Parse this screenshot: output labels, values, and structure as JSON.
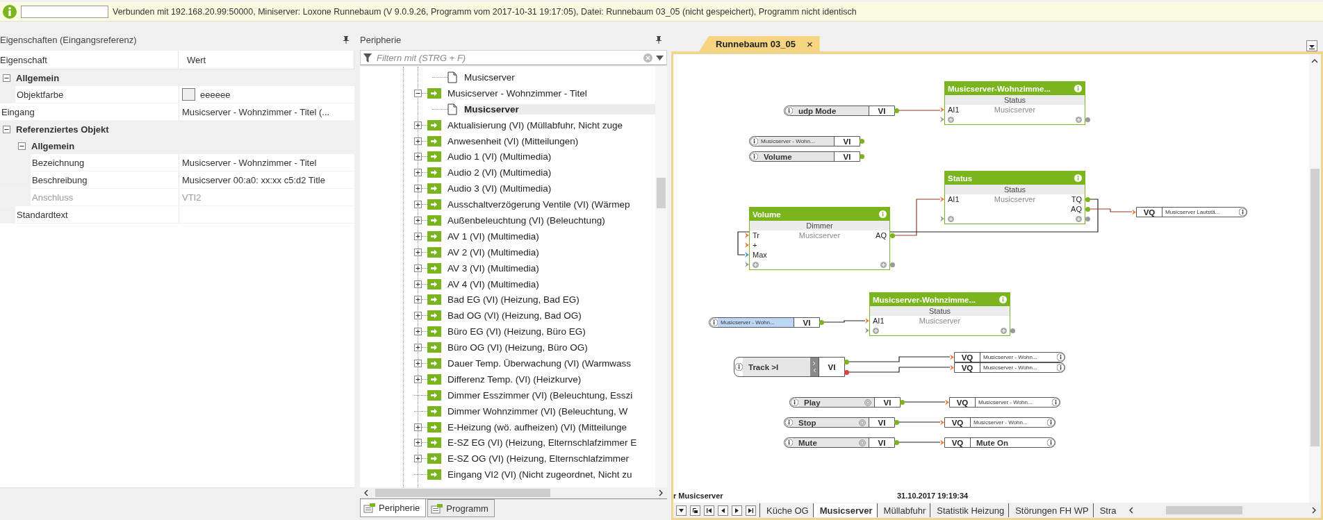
{
  "status_bar": {
    "message": "Verbunden mit 192.168.20.99:50000, Miniserver: Loxone Runnebaum (V 9.0.9.26, Programm vom 2017-10-31 19:17:05), Datei: Runnebaum 03_05 (nicht gespeichert), Programm nicht identisch"
  },
  "properties": {
    "title": "Eigenschaften (Eingangsreferenz)",
    "columns": [
      "Eigenschaft",
      "Wert"
    ],
    "rows": [
      {
        "kind": "category",
        "label": "Allgemein",
        "expanded": true,
        "children": [
          {
            "kind": "color",
            "label": "Objektfarbe",
            "value": "eeeeee",
            "color": "#eeeeee",
            "disabled": false
          }
        ]
      },
      {
        "kind": "property",
        "label": "Eingang",
        "value": "Musicserver - Wohnzimmer - Titel (...",
        "disabled": false
      },
      {
        "kind": "category",
        "label": "Referenziertes Objekt",
        "expanded": true,
        "children": [
          {
            "kind": "category",
            "label": "Allgemein",
            "expanded": true,
            "children": [
              {
                "kind": "property",
                "label": "Bezeichnung",
                "value": "Musicserver - Wohnzimmer - Titel",
                "disabled": false
              },
              {
                "kind": "property",
                "label": "Beschreibung",
                "value": "Musicserver 00:a0: xx:xx c5:d2 Title",
                "disabled": false
              },
              {
                "kind": "property",
                "label": "Anschluss",
                "value": "VTI2",
                "disabled": true
              }
            ]
          },
          {
            "kind": "property",
            "label": "Standardtext",
            "disabled": false
          }
        ]
      }
    ]
  },
  "periphery": {
    "title": "Peripherie",
    "filter": {
      "placeholder": "Filtern mit (STRG + F)"
    },
    "tree": [
      {
        "kind": "scrolled_parent",
        "children": [
          {
            "kind": "document",
            "label": "Musicserver",
            "selected": false
          }
        ]
      },
      {
        "kind": "input",
        "label": "Musicserver - Wohnzimmer - Titel",
        "expandable": true,
        "expanded": true,
        "selected": false,
        "children": [
          {
            "kind": "document",
            "label": "Musicserver",
            "selected": true
          }
        ]
      },
      {
        "kind": "input",
        "label": "Aktualisierung (VI) (Müllabfuhr, Nicht zuge",
        "expandable": true,
        "expanded": false,
        "selected": false
      },
      {
        "kind": "input",
        "label": "Anwesenheit (VI) (Mitteilungen)",
        "expandable": true,
        "expanded": false,
        "selected": false
      },
      {
        "kind": "input",
        "label": "Audio 1 (VI) (Multimedia)",
        "expandable": true,
        "expanded": false,
        "selected": false
      },
      {
        "kind": "input",
        "label": "Audio 2 (VI) (Multimedia)",
        "expandable": true,
        "expanded": false,
        "selected": false
      },
      {
        "kind": "input",
        "label": "Audio 3 (VI) (Multimedia)",
        "expandable": true,
        "expanded": false,
        "selected": false
      },
      {
        "kind": "input",
        "label": "Ausschaltverzögerung Ventile (VI) (Wärmep",
        "expandable": true,
        "expanded": false,
        "selected": false
      },
      {
        "kind": "input",
        "label": "Außenbeleuchtung (VI) (Beleuchtung)",
        "expandable": true,
        "expanded": false,
        "selected": false
      },
      {
        "kind": "input",
        "label": "AV 1 (VI) (Multimedia)",
        "expandable": true,
        "expanded": false,
        "selected": false
      },
      {
        "kind": "input",
        "label": "AV 2 (VI) (Multimedia)",
        "expandable": true,
        "expanded": false,
        "selected": false
      },
      {
        "kind": "input",
        "label": "AV 3 (VI) (Multimedia)",
        "expandable": true,
        "expanded": false,
        "selected": false
      },
      {
        "kind": "input",
        "label": "AV 4 (VI) (Multimedia)",
        "expandable": true,
        "expanded": false,
        "selected": false
      },
      {
        "kind": "input",
        "label": "Bad EG (VI) (Heizung, Bad EG)",
        "expandable": true,
        "expanded": false,
        "selected": false
      },
      {
        "kind": "input",
        "label": "Bad OG (VI) (Heizung, Bad OG)",
        "expandable": true,
        "expanded": false,
        "selected": false
      },
      {
        "kind": "input",
        "label": "Büro EG (VI) (Heizung, Büro EG)",
        "expandable": true,
        "expanded": false,
        "selected": false
      },
      {
        "kind": "input",
        "label": "Büro OG (VI) (Heizung, Büro OG)",
        "expandable": true,
        "expanded": false,
        "selected": false
      },
      {
        "kind": "input",
        "label": "Dauer Temp. Überwachung (VI) (Warmwass",
        "expandable": true,
        "expanded": false,
        "selected": false
      },
      {
        "kind": "input",
        "label": "Differenz Temp. (VI) (Heizkurve)",
        "expandable": true,
        "expanded": false,
        "selected": false
      },
      {
        "kind": "input",
        "label": "Dimmer Esszimmer (VI) (Beleuchtung, Esszi",
        "expandable": false,
        "selected": false
      },
      {
        "kind": "input",
        "label": "Dimmer Wohnzimmer (VI) (Beleuchtung, W",
        "expandable": false,
        "selected": false
      },
      {
        "kind": "input",
        "label": "E-Heizung (wö. aufheizen) (VI) (Mitteilunge",
        "expandable": true,
        "expanded": false,
        "selected": false
      },
      {
        "kind": "input",
        "label": "E-SZ EG (VI) (Heizung, Elternschlafzimmer E",
        "expandable": true,
        "expanded": false,
        "selected": false
      },
      {
        "kind": "input",
        "label": "E-SZ OG (VI) (Heizung, Elternschlafzimmer",
        "expandable": true,
        "expanded": false,
        "selected": false
      },
      {
        "kind": "input",
        "label": "Eingang VI2 (VI) (Nicht zugeordnet, Nicht zu",
        "expandable": false,
        "selected": false
      }
    ],
    "tabs": [
      {
        "label": "Peripherie",
        "selected": true
      },
      {
        "label": "Programm",
        "selected": false
      }
    ]
  },
  "document": {
    "tabs": [
      {
        "label": "Runnebaum 03_05",
        "close": "×",
        "selected": true
      }
    ],
    "canvas": {
      "items": [
        {
          "kind": "block",
          "title": "Musicserver-Wohnzimme...",
          "type": "Status",
          "subtitle": "Musicserver",
          "inputs": [
            {
              "label": "AI1",
              "kind": "input"
            }
          ]
        },
        {
          "kind": "virtual_input",
          "label": "udp Mode",
          "port": "VI",
          "push_button": false,
          "step_buttons": false,
          "small": false,
          "selected": false
        },
        {
          "kind": "virtual_input",
          "label": "Musicserver - Wohn...",
          "port": "VI",
          "push_button": false,
          "step_buttons": false,
          "small": true,
          "selected": false
        },
        {
          "kind": "virtual_input",
          "label": "Volume",
          "port": "VI",
          "push_button": false,
          "step_buttons": false,
          "small": false,
          "selected": false
        },
        {
          "kind": "block",
          "title": "Status",
          "type": "Status",
          "subtitle": "Musicserver",
          "inputs": [
            {
              "label": "AI1",
              "kind": "input"
            }
          ],
          "outputs": [
            "TQ",
            "AQ"
          ]
        },
        {
          "kind": "block",
          "title": "Volume",
          "type": "Dimmer",
          "subtitle": "Musicserver",
          "inputs": [
            {
              "label": "Tr",
              "kind": "input"
            },
            {
              "label": "+",
              "kind": "input"
            },
            {
              "label": "Max",
              "kind": "parameter"
            }
          ],
          "outputs": [
            "AQ"
          ]
        },
        {
          "kind": "virtual_output",
          "label": "Musicserver Lautstä...",
          "port": "VQ",
          "small": true
        },
        {
          "kind": "virtual_input",
          "label": "Musicserver - Wohn...",
          "port": "VI",
          "push_button": false,
          "step_buttons": false,
          "small": true,
          "selected": true
        },
        {
          "kind": "block",
          "title": "Musicserver-Wohnzimme...",
          "type": "Status",
          "subtitle": "Musicserver",
          "inputs": [
            {
              "label": "AI1",
              "kind": "input"
            }
          ]
        },
        {
          "kind": "virtual_input",
          "label": "Track >I",
          "port": "VI",
          "push_button": false,
          "step_buttons": true,
          "small": false,
          "selected": false
        },
        {
          "kind": "virtual_output",
          "label": "Musicserver - Wohn...",
          "port": "VQ",
          "small": true
        },
        {
          "kind": "virtual_output",
          "label": "Musicserver - Wohn...",
          "port": "VQ",
          "small": true
        },
        {
          "kind": "virtual_input",
          "label": "Play",
          "port": "VI",
          "push_button": true,
          "step_buttons": false,
          "small": false,
          "selected": false
        },
        {
          "kind": "virtual_output",
          "label": "Musicserver - Wohn...",
          "port": "VQ",
          "small": true
        },
        {
          "kind": "virtual_input",
          "label": "Stop",
          "port": "VI",
          "push_button": true,
          "step_buttons": false,
          "small": false,
          "selected": false
        },
        {
          "kind": "virtual_output",
          "label": "Musicserver - Wohn...",
          "port": "VQ",
          "small": true
        },
        {
          "kind": "virtual_input",
          "label": "Mute",
          "port": "VI",
          "push_button": true,
          "step_buttons": false,
          "small": false,
          "selected": false
        },
        {
          "kind": "virtual_output",
          "label": "Mute On",
          "port": "VQ",
          "small": false
        }
      ],
      "page_name": "r Musicserver",
      "timestamp": "31.10.2017 19:19:34"
    },
    "pages": [
      {
        "label": "Küche OG",
        "selected": false
      },
      {
        "label": "Musicserver",
        "selected": true
      },
      {
        "label": "Müllabfuhr",
        "selected": false
      },
      {
        "label": "Statistik Heizung",
        "selected": false
      },
      {
        "label": "Störungen FH WP",
        "selected": false
      },
      {
        "label": "Stra",
        "selected": false
      }
    ]
  }
}
